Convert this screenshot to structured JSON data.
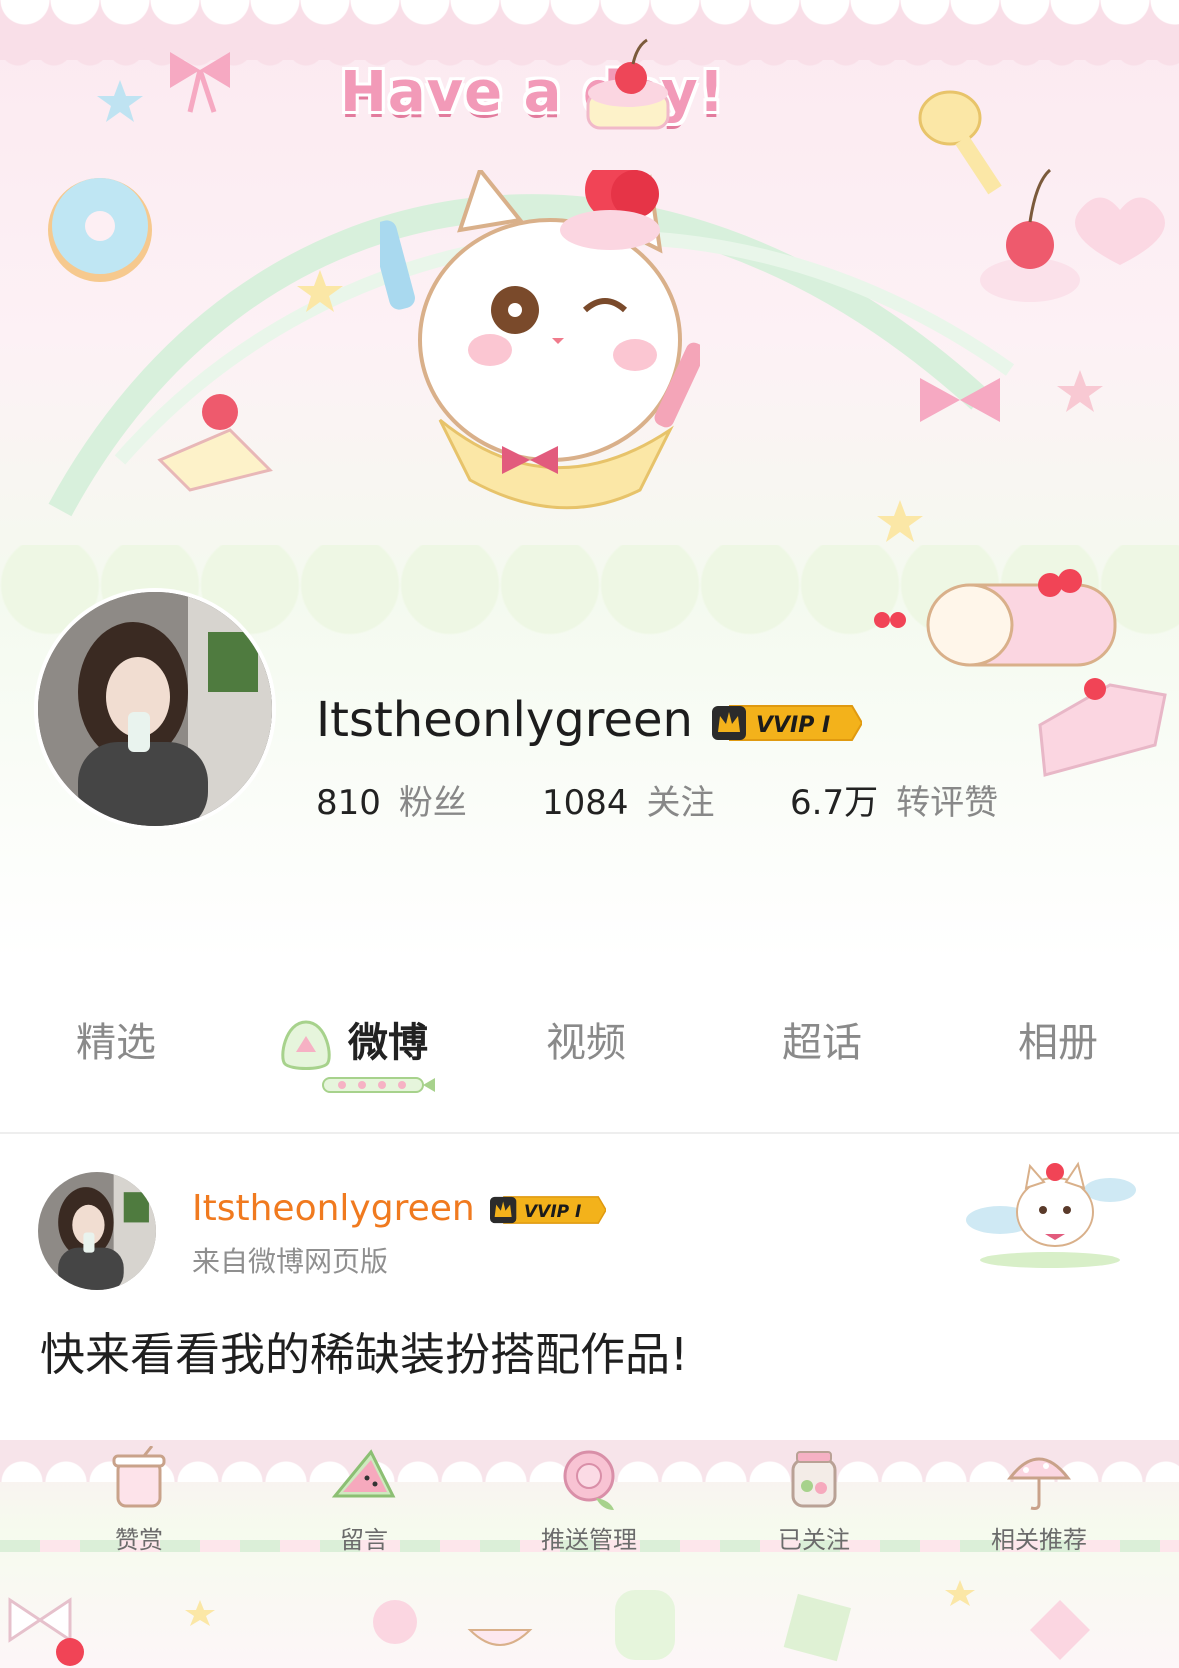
{
  "banner": {
    "title": "Have a day!"
  },
  "profile": {
    "name": "Itstheonlygreen",
    "badge": "VVIP I",
    "stats": [
      {
        "value": "810",
        "label": "粉丝"
      },
      {
        "value": "1084",
        "label": "关注"
      },
      {
        "value": "6.7万",
        "label": "转评赞"
      }
    ]
  },
  "tabs": [
    {
      "label": "精选",
      "active": false
    },
    {
      "label": "微博",
      "active": true
    },
    {
      "label": "视频",
      "active": false
    },
    {
      "label": "超话",
      "active": false
    },
    {
      "label": "相册",
      "active": false
    }
  ],
  "post": {
    "author": "Itstheonlygreen",
    "badge": "VVIP I",
    "source": "来自微博网页版",
    "text": "快来看看我的稀缺装扮搭配作品!"
  },
  "actions": [
    {
      "label": "赞赏",
      "icon": "cup-icon"
    },
    {
      "label": "留言",
      "icon": "watermelon-icon"
    },
    {
      "label": "推送管理",
      "icon": "flower-icon"
    },
    {
      "label": "已关注",
      "icon": "jar-icon"
    },
    {
      "label": "相关推荐",
      "icon": "umbrella-icon"
    }
  ],
  "colors": {
    "accent_orange": "#f07a1f",
    "badge_gold": "#f3b21b",
    "banner_pink": "#f29ab8"
  }
}
